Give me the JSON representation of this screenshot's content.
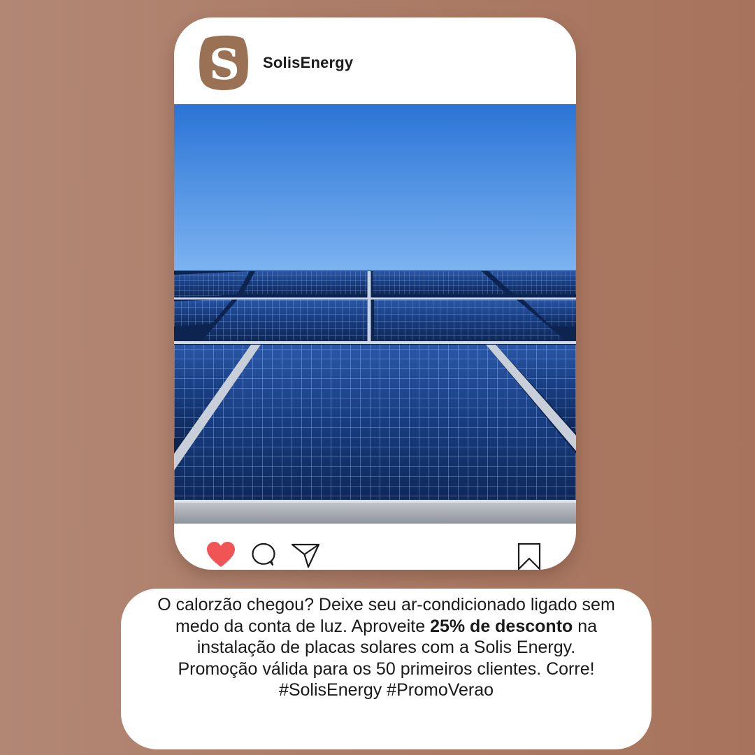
{
  "post": {
    "username": "SolisEnergy",
    "avatar_letter": "S",
    "photo_icon": "solar-panels-photo",
    "actions": {
      "like_icon": "heart-icon",
      "comment_icon": "comment-icon",
      "share_icon": "send-icon",
      "save_icon": "bookmark-icon",
      "liked": true
    }
  },
  "caption": {
    "part1": "O calorzão chegou? Deixe seu ar-condicionado ligado sem medo da conta de luz. Aproveite ",
    "bold": "25% de desconto",
    "part2": " na instalação de placas solares com a Solis Energy. Promoção válida para os 50 primeiros clientes. Corre! #SolisEnergy #PromoVerao"
  },
  "colors": {
    "background": "#ab7c67",
    "card": "#ffffff",
    "avatar_badge": "#9a7154",
    "heart": "#f05454",
    "sky_top": "#2b74d6",
    "sky_bottom": "#80b6f2",
    "panel": "#12306a"
  }
}
